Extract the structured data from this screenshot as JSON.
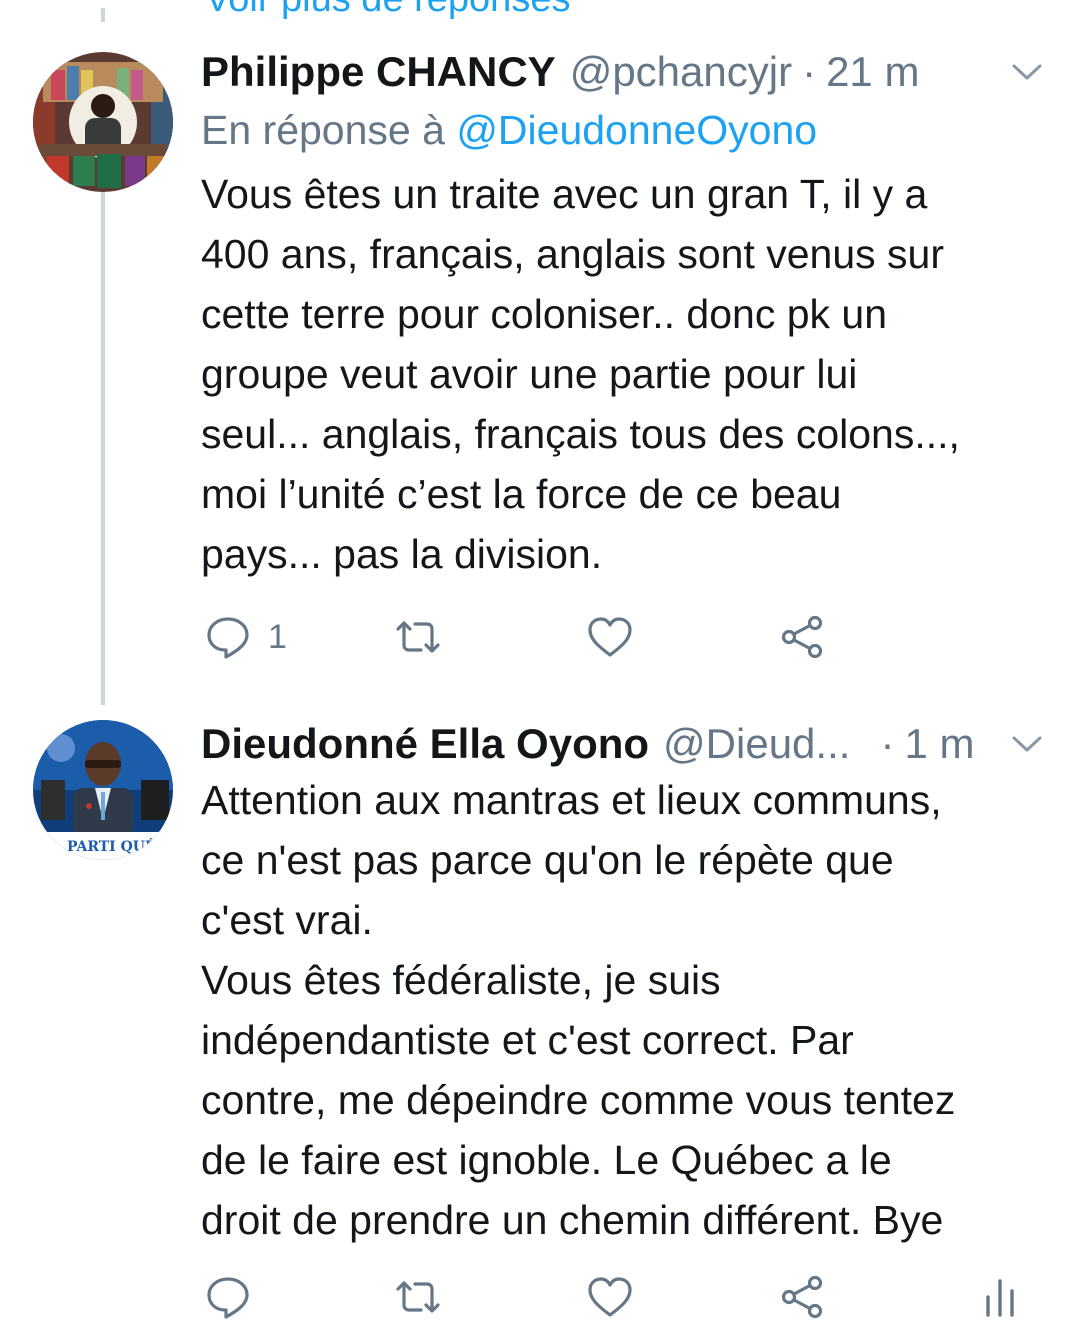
{
  "top_link": {
    "label": "Voir plus de réponses"
  },
  "tweets": [
    {
      "author": "Philippe CHANCY",
      "handle": "@pchancyjr",
      "separator": "·",
      "time": "21 m",
      "reply_prefix": "En réponse à",
      "reply_mention": "@DieudonneOyono",
      "text": "Vous êtes un traite avec un gran T, il y a\n400 ans, français, anglais sont venus sur\ncette terre pour coloniser.. donc pk un\ngroupe veut avoir une partie pour lui\nseul... anglais, français tous des colons...,\nmoi l’unité c’est la force de ce beau\npays... pas la division.",
      "reply_count": "1"
    },
    {
      "author": "Dieudonné Ella Oyono",
      "handle": "@Dieud...",
      "separator": "·",
      "time": "1 m",
      "text": "Attention aux mantras et lieux communs,\nce n'est pas parce qu'on le répète que\nc'est vrai.\nVous êtes fédéraliste, je suis\nindépendantiste et c'est correct. Par\ncontre, me dépeindre comme vous tentez\nde le faire est ignoble. Le Québec a le\ndroit de prendre un chemin différent. Bye",
      "avatar_banner": "PARTI QUÉBÉCOIS"
    }
  ],
  "colors": {
    "text": "#14171a",
    "secondary": "#657786",
    "link": "#1da1f2",
    "thread_line": "#ccd6dd"
  },
  "icons": [
    "reply-icon",
    "retweet-icon",
    "like-icon",
    "share-icon",
    "analytics-icon",
    "chevron-down-icon"
  ]
}
